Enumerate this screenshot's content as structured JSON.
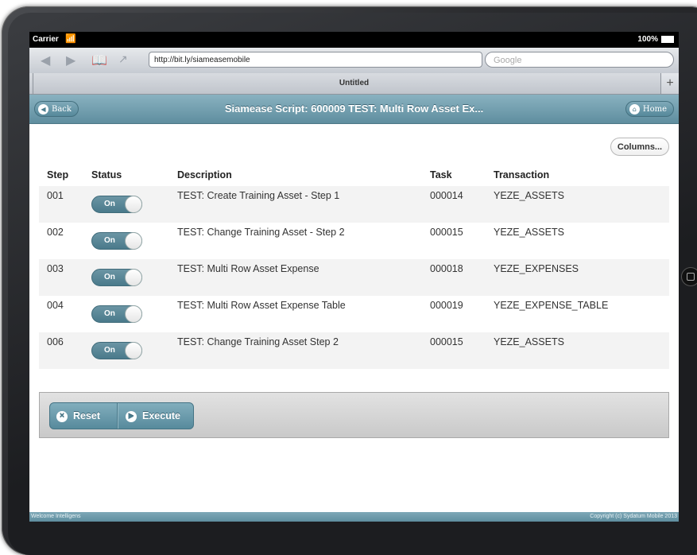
{
  "statusbar": {
    "carrier": "Carrier",
    "battery": "100%"
  },
  "browser": {
    "url": "http://bit.ly/siameasemobile",
    "search_placeholder": "Google",
    "tab_title": "Untitled",
    "new_tab_label": "+"
  },
  "header": {
    "back_label": "Back",
    "title": "Siamease Script: 600009 TEST: Multi Row Asset Ex...",
    "home_label": "Home"
  },
  "columns_button": "Columns...",
  "table": {
    "headers": [
      "Step",
      "Status",
      "Description",
      "Task",
      "Transaction"
    ],
    "rows": [
      {
        "step": "001",
        "status": "On",
        "description": "TEST: Create Training Asset - Step 1",
        "task": "000014",
        "transaction": "YEZE_ASSETS"
      },
      {
        "step": "002",
        "status": "On",
        "description": "TEST: Change Training Asset - Step 2",
        "task": "000015",
        "transaction": "YEZE_ASSETS"
      },
      {
        "step": "003",
        "status": "On",
        "description": "TEST: Multi Row Asset Expense",
        "task": "000018",
        "transaction": "YEZE_EXPENSES"
      },
      {
        "step": "004",
        "status": "On",
        "description": "TEST: Multi Row Asset Expense Table",
        "task": "000019",
        "transaction": "YEZE_EXPENSE_TABLE"
      },
      {
        "step": "006",
        "status": "On",
        "description": "TEST: Change Training Asset Step 2",
        "task": "000015",
        "transaction": "YEZE_ASSETS"
      }
    ]
  },
  "actions": {
    "reset_label": "Reset",
    "execute_label": "Execute"
  },
  "footer": {
    "left": "Welcome Intelligens",
    "right": "Copyright (c) Sydatum Mobile 2013"
  },
  "colors": {
    "accent": "#5f8e9f",
    "toggle": "#4a7a8b"
  }
}
